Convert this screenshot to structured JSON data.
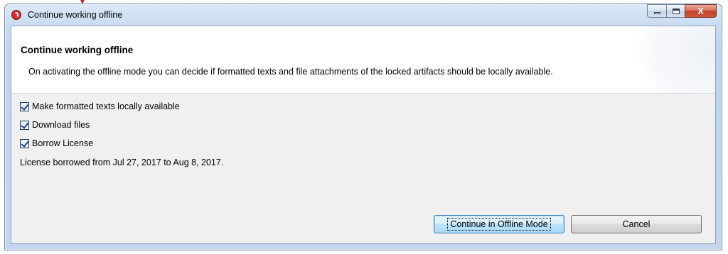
{
  "window": {
    "title": "Continue working offline",
    "controls": {
      "minimize": "minimize",
      "maximize": "maximize",
      "close": "X"
    }
  },
  "header": {
    "title": "Continue working offline",
    "description": "On activating the offline mode you can decide if formatted texts and file attachments of the locked artifacts should be locally available."
  },
  "options": [
    {
      "label": "Make formatted texts locally available",
      "checked": true
    },
    {
      "label": "Download files",
      "checked": true
    },
    {
      "label": "Borrow License",
      "checked": true
    }
  ],
  "license_info": "License borrowed from Jul 27, 2017 to Aug 8, 2017.",
  "buttons": {
    "primary": "Continue in Offline Mode",
    "cancel": "Cancel"
  },
  "colors": {
    "title_gradient_top": "#dbe9f8",
    "close_button": "#c2422a",
    "dialog_body": "#f0f0f0",
    "primary_button": "#bee6fd"
  }
}
